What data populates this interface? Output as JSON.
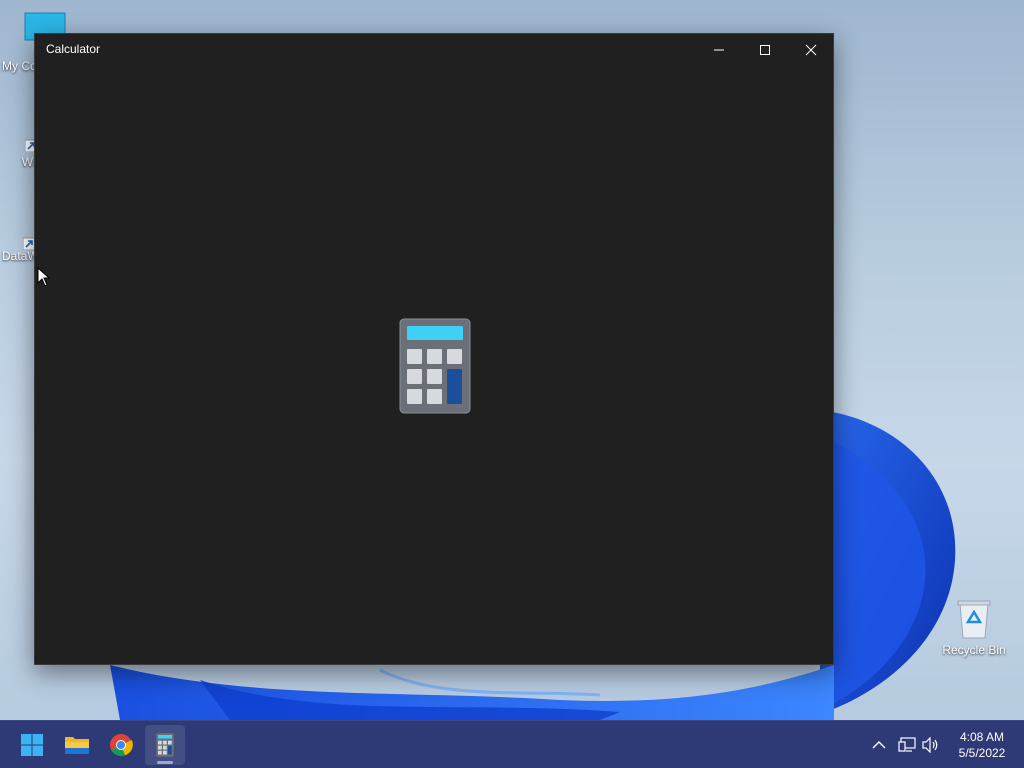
{
  "desktop": {
    "icons": [
      {
        "label": "My Co",
        "icon": "monitor-icon"
      },
      {
        "label": "Wi Tw",
        "icon": "app-shortcut-icon"
      },
      {
        "label": "DataW",
        "icon": "datawrapper-shortcut-icon"
      },
      {
        "label": "Recycle Bin",
        "icon": "recycle-bin-icon"
      }
    ]
  },
  "window": {
    "title": "Calculator",
    "controls": {
      "minimize": "minimize-icon",
      "maximize": "maximize-icon",
      "close": "close-icon"
    },
    "splash_icon": "calculator-icon",
    "background": "#202020"
  },
  "taskbar": {
    "apps": [
      {
        "name": "start",
        "icon": "windows-start-icon"
      },
      {
        "name": "file-explorer",
        "icon": "folder-icon"
      },
      {
        "name": "chrome",
        "icon": "chrome-icon"
      },
      {
        "name": "calculator",
        "icon": "calculator-icon",
        "active": true
      }
    ],
    "tray": [
      "chevron-up-icon",
      "network-icon",
      "volume-icon"
    ],
    "time": "4:08 AM",
    "date": "5/5/2022",
    "color": "#2e3a75"
  }
}
